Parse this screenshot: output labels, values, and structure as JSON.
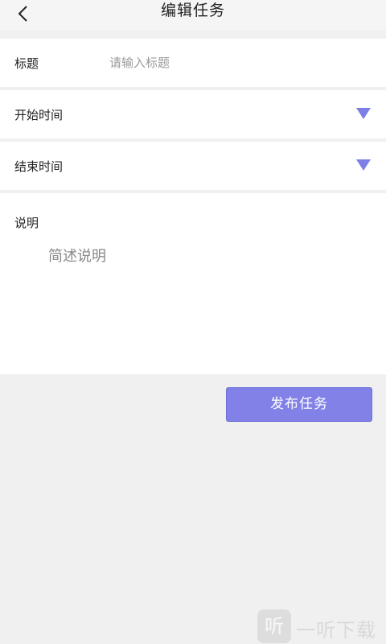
{
  "header": {
    "title": "编辑任务",
    "back_icon": "chevron-left-icon"
  },
  "form": {
    "title": {
      "label": "标题",
      "placeholder": "请输入标题",
      "value": ""
    },
    "start_time": {
      "label": "开始时间",
      "icon": "dropdown-triangle-icon"
    },
    "end_time": {
      "label": "结束时间",
      "icon": "dropdown-triangle-icon"
    },
    "description": {
      "label": "说明",
      "placeholder": "简述说明",
      "value": ""
    }
  },
  "actions": {
    "publish_label": "发布任务"
  },
  "watermark": {
    "logo_char": "听",
    "text": "一听下载"
  },
  "colors": {
    "accent": "#8181e8",
    "background": "#f0f0f0",
    "row_background": "#ffffff"
  }
}
